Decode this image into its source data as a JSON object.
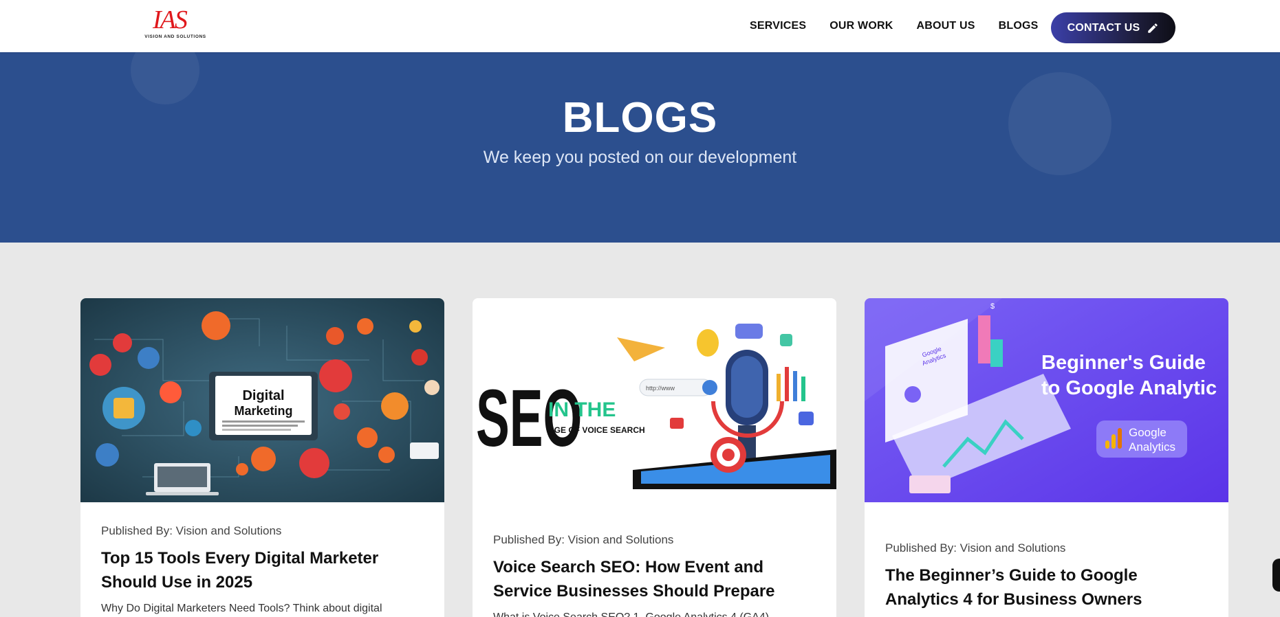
{
  "logo": {
    "mark": "IAS",
    "tagline": "VISION AND SOLUTIONS"
  },
  "nav": {
    "items": [
      "SERVICES",
      "OUR WORK",
      "ABOUT US",
      "BLOGS"
    ],
    "contact_label": "CONTACT US"
  },
  "hero": {
    "title": "BLOGS",
    "subtitle": "We keep you posted on our development"
  },
  "cards": [
    {
      "image_text": [
        "Digital",
        "Marketing"
      ],
      "meta": "Published By: Vision and Solutions",
      "title": "Top 15 Tools Every Digital Marketer Should Use in 2025",
      "excerpt": "Why Do Digital Marketers Need Tools? Think about digital"
    },
    {
      "image_text": [
        "SEO",
        "IN THE",
        "AGE OF VOICE SEARCH",
        "http://www"
      ],
      "meta": "Published By: Vision and Solutions",
      "title": "Voice Search SEO: How Event and Service Businesses Should Prepare",
      "excerpt": "What is Voice Search SEO? 1. Google Analytics 4 (GA4)"
    },
    {
      "image_text": [
        "Beginner's Guide",
        "to Google Analytic",
        "Google",
        "Analytics",
        "Google Analytics",
        "$"
      ],
      "meta": "Published By: Vision and Solutions",
      "title": "The Beginner’s Guide to Google Analytics 4 for Business Owners",
      "excerpt": ""
    }
  ],
  "colors": {
    "hero_bg": "#2c4f8e",
    "page_bg": "#e8e8e8",
    "logo_red": "#e0181c",
    "analytics_purple": "#6a45f0",
    "seo_green": "#24c48c"
  }
}
